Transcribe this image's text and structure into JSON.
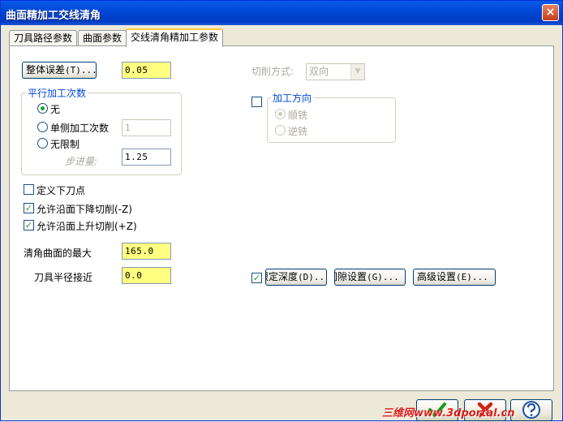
{
  "window": {
    "title": "曲面精加工交线清角",
    "close_label": "×"
  },
  "tabs": [
    {
      "label": "刀具路径参数"
    },
    {
      "label": "曲面参数"
    },
    {
      "label": "交线清角精加工参数"
    }
  ],
  "total_tolerance": {
    "button_label": "整体误差",
    "button_key": "(T)...",
    "value": "0.05"
  },
  "parallel_passes": {
    "legend": "平行加工次数",
    "options": [
      "无",
      "单侧加工次数",
      "无限制"
    ],
    "selected": "无",
    "single_side_count": "1",
    "stepover_label": "步进量:",
    "stepover_value": "1.25"
  },
  "cut_method": {
    "label": "切削方式:",
    "value": "双向"
  },
  "machining_direction": {
    "legend": "加工方向",
    "checked": false,
    "options": [
      "顺铣",
      "逆铣"
    ],
    "selected": "顺铣"
  },
  "options": {
    "define_plunge_point": {
      "label": "定义下刀点",
      "checked": false
    },
    "allow_down_cut": {
      "label": "允许沿面下降切削(-Z)",
      "checked": true
    },
    "allow_up_cut": {
      "label": "允许沿面上升切削(+Z)",
      "checked": true
    }
  },
  "max_corner_angle": {
    "label": "清角曲面的最大",
    "value": "165.0"
  },
  "tool_radius_approach": {
    "label": "刀具半径接近",
    "value": "0.0"
  },
  "buttons": {
    "depth_checked": true,
    "depth_label": "限定深度",
    "depth_key": "(D)...",
    "gap_label": "间隙设置",
    "gap_key": "(G)...",
    "advanced_label": "高级设置",
    "advanced_key": "(E)..."
  },
  "watermark": "三维网www.3dportal.cn",
  "colors": {
    "title_bar": "#0054e3",
    "field_highlight": "#ffff80",
    "group_legend": "#0046d5",
    "watermark": "#d8201c"
  }
}
